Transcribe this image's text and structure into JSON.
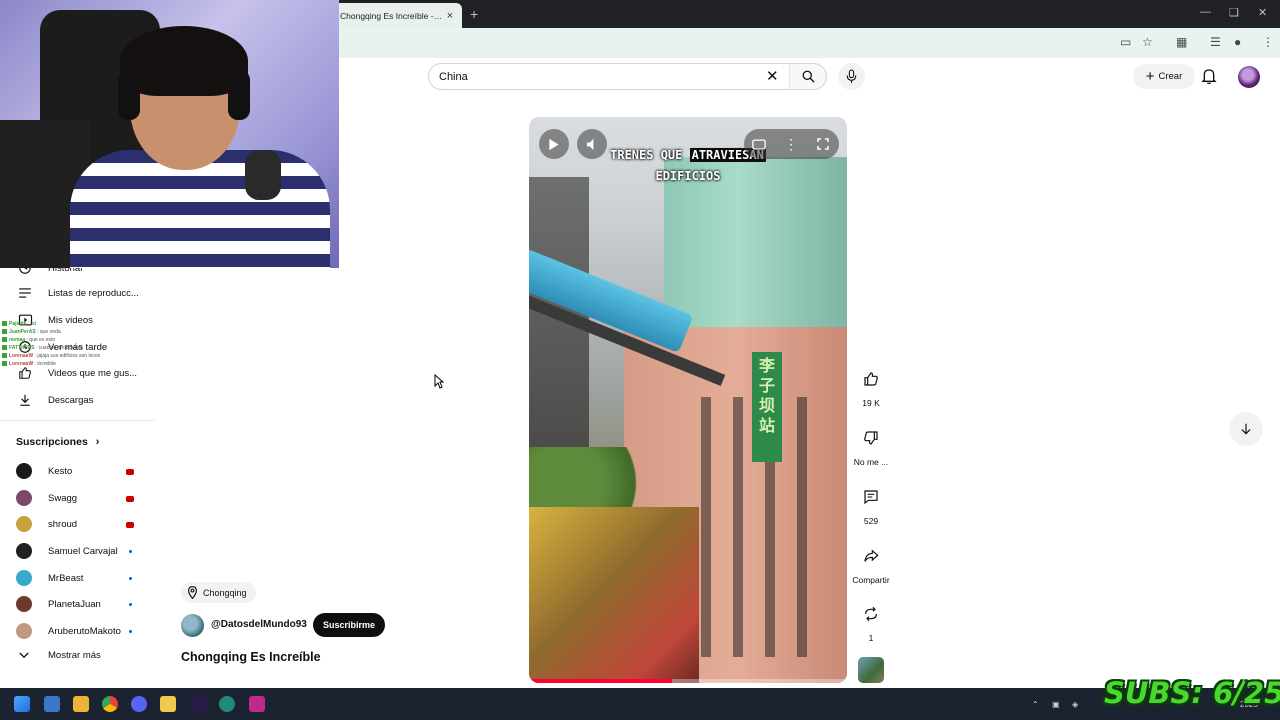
{
  "browser": {
    "tab_title": "Chongqing Es Increíble - YouTube",
    "tab_close": "×",
    "new_tab": "+"
  },
  "header": {
    "search_value": "China",
    "create_label": "Crear"
  },
  "sidebar": {
    "items": [
      {
        "label": "Historial",
        "icon": "history-icon"
      },
      {
        "label": "Listas de reproducc...",
        "icon": "playlist-icon"
      },
      {
        "label": "Mis videos",
        "icon": "my-videos-icon"
      },
      {
        "label": "Ver más tarde",
        "icon": "watch-later-icon"
      },
      {
        "label": "Videos que me gus...",
        "icon": "liked-icon"
      },
      {
        "label": "Descargas",
        "icon": "download-icon"
      }
    ],
    "subscriptions_title": "Suscripciones",
    "subscriptions": [
      {
        "name": "Kesto",
        "status": "live",
        "color": "#1a1a1a"
      },
      {
        "name": "Swagg",
        "status": "live",
        "color": "#7a4a6a"
      },
      {
        "name": "shroud",
        "status": "live",
        "color": "#c8a040"
      },
      {
        "name": "Samuel Carvajal",
        "status": "new",
        "color": "#222222"
      },
      {
        "name": "MrBeast",
        "status": "new",
        "color": "#3aa8c8"
      },
      {
        "name": "PlanetaJuan",
        "status": "new",
        "color": "#6a3a2a"
      },
      {
        "name": "AruberutoMakoto",
        "status": "new",
        "color": "#c09a80"
      }
    ],
    "show_more": "Mostrar más"
  },
  "chat": {
    "lines": [
      {
        "user": "Pajicite",
        "text": "xd"
      },
      {
        "user": "JuanPerAS",
        "text": "que onda"
      },
      {
        "user": "nomaa",
        "text": "que es esto"
      },
      {
        "user": "FATTIKIDS",
        "text": "cuantos años tienes"
      },
      {
        "user": "LorenaaW",
        "text": "jajaja sus edificios son locos"
      },
      {
        "user": "LorenaaW",
        "text": "increible"
      }
    ]
  },
  "short": {
    "location": "Chongqing",
    "channel": "@DatosdelMundo93",
    "subscribe_label": "Suscribirme",
    "title": "Chongqing Es Increíble",
    "caption_line1_pre": "TRENES QUE ",
    "caption_line1_hl": "ATRAVIESAN",
    "caption_line2": "EDIFICIOS",
    "sign_text": "李子坝站",
    "progress": 0.45
  },
  "actions": {
    "likes": "19 K",
    "dislike_label": "No me ...",
    "comments": "529",
    "share_label": "Compartir",
    "remix": "1"
  },
  "stream_overlay": {
    "subs_text": "SUBS: 6/25"
  },
  "taskbar": {
    "time": "2025"
  }
}
